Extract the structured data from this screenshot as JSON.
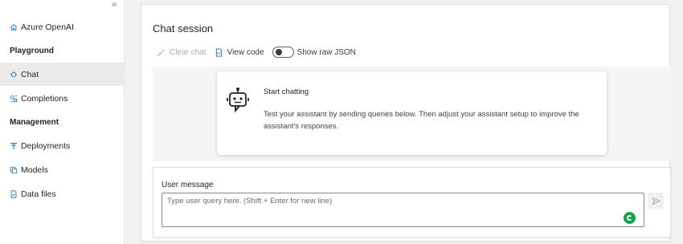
{
  "sidebar": {
    "collapse_glyph": "«",
    "items": [
      {
        "label": "Azure OpenAI",
        "icon": "home-icon"
      },
      {
        "label": "Chat",
        "icon": "chat-icon",
        "active": true
      },
      {
        "label": "Completions",
        "icon": "completions-icon"
      },
      {
        "label": "Deployments",
        "icon": "deployments-icon"
      },
      {
        "label": "Models",
        "icon": "models-icon"
      },
      {
        "label": "Data files",
        "icon": "data-files-icon"
      }
    ],
    "sections": {
      "playground": "Playground",
      "management": "Management"
    }
  },
  "main": {
    "title": "Chat session",
    "toolbar": {
      "clear_chat": "Clear chat",
      "view_code": "View code",
      "show_raw_json": "Show raw JSON",
      "show_raw_json_on": false
    },
    "welcome": {
      "title": "Start chatting",
      "body": "Test your assistant by sending queries below. Then adjust your assistant setup to improve the assistant's responses."
    },
    "user_message": {
      "label": "User message",
      "placeholder": "Type user query here. (Shift + Enter for new line)",
      "value": ""
    }
  },
  "colors": {
    "accent_blue": "#0f6cbd",
    "active_nav_bg": "#edebe9",
    "grammarly_green": "#15a24a"
  }
}
